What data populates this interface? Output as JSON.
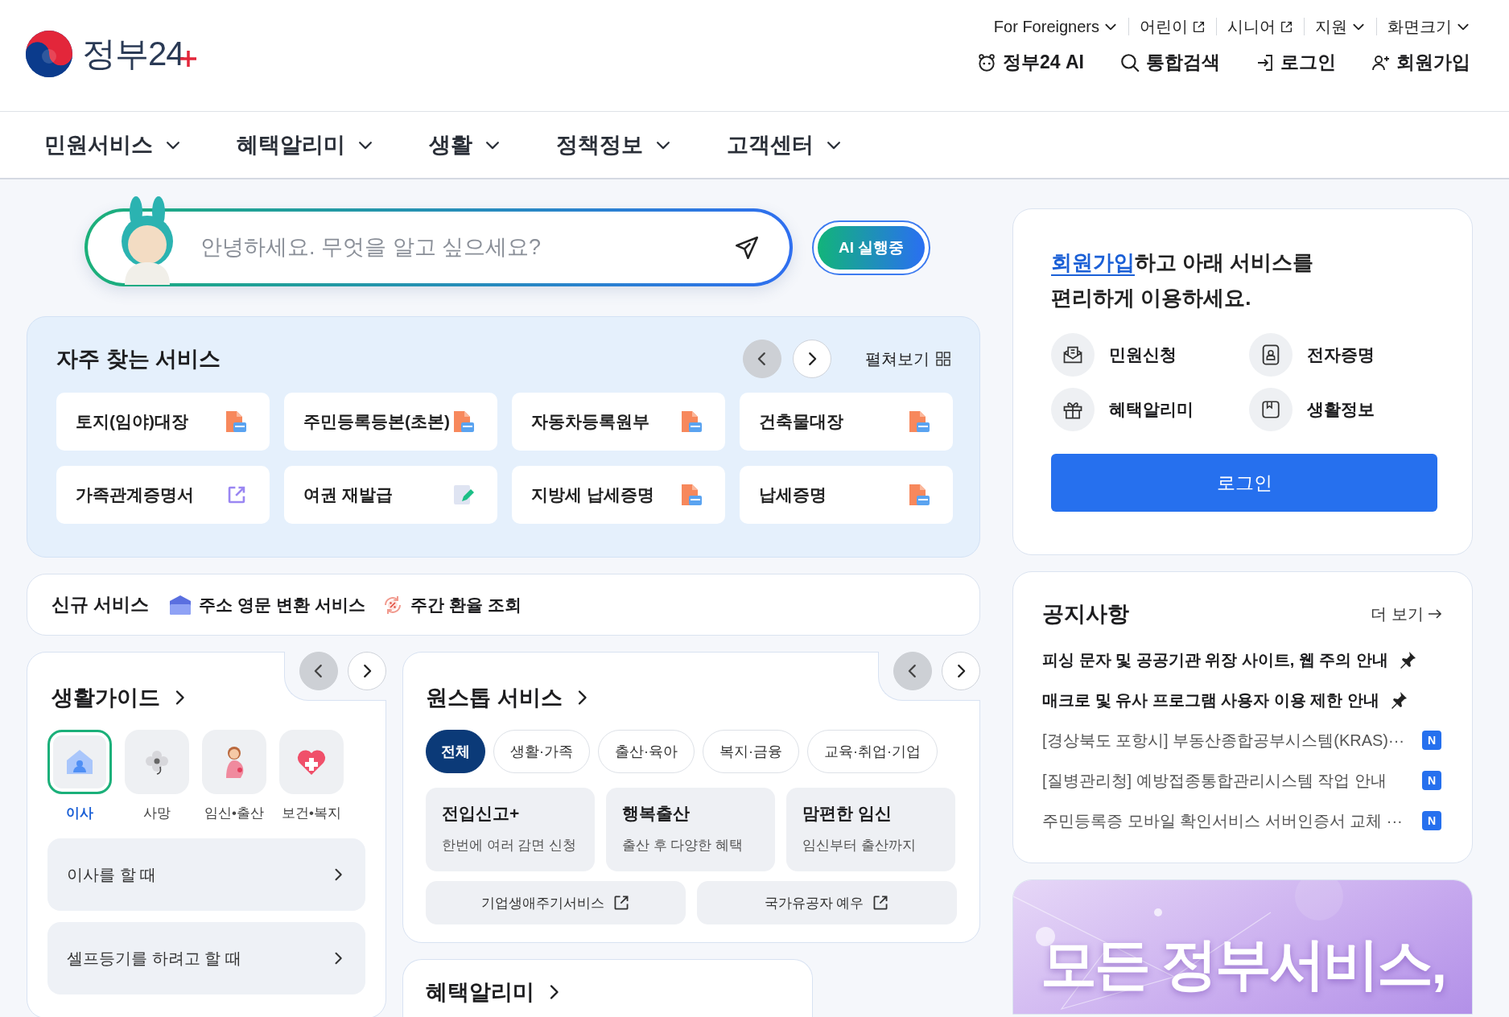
{
  "header": {
    "logo_text": "정부24",
    "top_links": [
      {
        "label": "For Foreigners",
        "kind": "menu"
      },
      {
        "label": "어린이",
        "kind": "external"
      },
      {
        "label": "시니어",
        "kind": "external"
      },
      {
        "label": "지원",
        "kind": "menu"
      },
      {
        "label": "화면크기",
        "kind": "menu"
      }
    ],
    "actions": [
      {
        "label": "정부24 AI",
        "kind": "ai"
      },
      {
        "label": "통합검색",
        "kind": "search"
      },
      {
        "label": "로그인",
        "kind": "login"
      },
      {
        "label": "회원가입",
        "kind": "signup"
      }
    ]
  },
  "nav": {
    "items": [
      "민원서비스",
      "혜택알리미",
      "생활",
      "정책정보",
      "고객센터"
    ]
  },
  "ai_search": {
    "placeholder": "안녕하세요. 무엇을 알고 싶으세요?",
    "status_button": "AI 실행중"
  },
  "frequent_services": {
    "title": "자주 찾는 서비스",
    "pager": [
      {
        "disabled": true
      },
      {
        "disabled": false
      }
    ],
    "expand_label": "펼쳐보기",
    "items": [
      {
        "label": "토지(임야)대장",
        "kind": "pdf"
      },
      {
        "label": "주민등록등본(초본)",
        "kind": "pdf"
      },
      {
        "label": "자동차등록원부",
        "kind": "pdf"
      },
      {
        "label": "건축물대장",
        "kind": "pdf"
      },
      {
        "label": "가족관계증명서",
        "kind": "link"
      },
      {
        "label": "여권 재발급",
        "kind": "edit"
      },
      {
        "label": "지방세 납세증명",
        "kind": "pdf"
      },
      {
        "label": "납세증명",
        "kind": "pdf"
      }
    ]
  },
  "new_services": {
    "label": "신규 서비스",
    "items": [
      {
        "label": "주소 영문 변환 서비스",
        "kind": "mailbox"
      },
      {
        "label": "주간 환율 조회",
        "kind": "exchange"
      }
    ]
  },
  "life_guide": {
    "title": "생활가이드",
    "pager": [
      {
        "disabled": true
      },
      {
        "disabled": false
      }
    ],
    "categories": [
      {
        "label": "이사",
        "kind": "house",
        "selected": true
      },
      {
        "label": "사망",
        "kind": "flower",
        "selected": false
      },
      {
        "label": "임신•출산",
        "kind": "pregnant",
        "selected": false
      },
      {
        "label": "보건•복지",
        "kind": "heart",
        "selected": false
      }
    ],
    "items": [
      "이사를 할 때",
      "셀프등기를 하려고 할 때"
    ]
  },
  "one_stop": {
    "title": "원스톱 서비스",
    "pager": [
      {
        "disabled": true
      },
      {
        "disabled": false
      }
    ],
    "filters": [
      {
        "label": "전체",
        "selected": true
      },
      {
        "label": "생활·가족",
        "selected": false
      },
      {
        "label": "출산·육아",
        "selected": false
      },
      {
        "label": "복지·금융",
        "selected": false
      },
      {
        "label": "교육·취업·기업",
        "selected": false
      }
    ],
    "services": [
      {
        "title": "전입신고+",
        "description": "한번에 여러 감면 신청"
      },
      {
        "title": "행복출산",
        "description": "출산 후 다양한 혜택"
      },
      {
        "title": "맘편한 임신",
        "description": "임신부터 출산까지"
      }
    ],
    "links": [
      "기업생애주기서비스",
      "국가유공자 예우"
    ]
  },
  "benefits": {
    "title": "혜택알리미"
  },
  "login_card": {
    "prompt_link": "회원가입",
    "prompt_lines": [
      "하고 아래 서비스를",
      "편리하게 이용하세요."
    ],
    "shortcuts": [
      {
        "label": "민원신청",
        "kind": "envelope"
      },
      {
        "label": "전자증명",
        "kind": "badge"
      },
      {
        "label": "혜택알리미",
        "kind": "gift"
      },
      {
        "label": "생활정보",
        "kind": "bookmark"
      }
    ],
    "button": "로그인"
  },
  "notices": {
    "title": "공지사항",
    "more": "더 보기",
    "items": [
      {
        "text": "피싱 문자 및 공공기관 위장 사이트, 웹 주의 안내",
        "pinned": true
      },
      {
        "text": "매크로 및 유사 프로그램 사용자 이용 제한 안내",
        "pinned": true
      },
      {
        "text": "[경상북도 포항시] 부동산종합공부시스템(KRAS)···",
        "pinned": false,
        "badge": "N"
      },
      {
        "text": "[질병관리청] 예방접종통합관리시스템 작업 안내",
        "pinned": false,
        "badge": "N"
      },
      {
        "text": "주민등록증 모바일 확인서비스 서버인증서 교체 ···",
        "pinned": false,
        "badge": "N"
      }
    ]
  },
  "banner": {
    "headline": "모든 정부서비스,"
  }
}
